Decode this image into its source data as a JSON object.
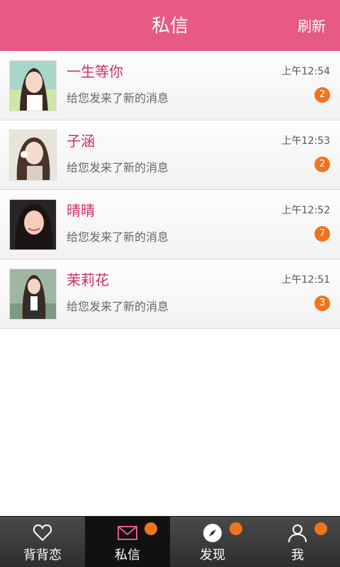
{
  "header": {
    "title": "私信",
    "refresh_label": "刷新"
  },
  "messages": [
    {
      "name": "一生等你",
      "time": "上午12:54",
      "preview": "给您发来了新的消息",
      "unread": "2"
    },
    {
      "name": "子涵",
      "time": "上午12:53",
      "preview": "给您发来了新的消息",
      "unread": "2"
    },
    {
      "name": "晴晴",
      "time": "上午12:52",
      "preview": "给您发来了新的消息",
      "unread": "7"
    },
    {
      "name": "茉莉花",
      "time": "上午12:51",
      "preview": "给您发来了新的消息",
      "unread": "3"
    }
  ],
  "tabs": [
    {
      "label": "背背恋",
      "icon": "heart-icon",
      "active": false,
      "has_dot": false
    },
    {
      "label": "私信",
      "icon": "mail-icon",
      "active": true,
      "has_dot": true
    },
    {
      "label": "发现",
      "icon": "compass-icon",
      "active": false,
      "has_dot": true
    },
    {
      "label": "我",
      "icon": "person-icon",
      "active": false,
      "has_dot": true
    }
  ],
  "colors": {
    "header_bg": "#e85a86",
    "name_text": "#d22a6a",
    "badge": "#f0731e",
    "tabbar_bg": "#3a3a3a",
    "active_tab_bg": "#111111"
  }
}
